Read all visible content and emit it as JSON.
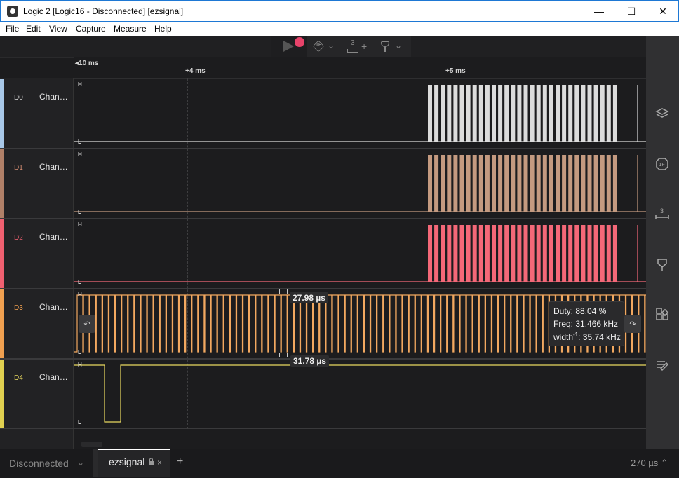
{
  "window": {
    "title": "Logic 2 [Logic16 - Disconnected] [ezsignal]",
    "minimize": "—",
    "maximize": "☐",
    "close": "✕"
  },
  "menu": [
    "File",
    "Edit",
    "View",
    "Capture",
    "Measure",
    "Help"
  ],
  "toolbar": {
    "record_color": "#e8436a",
    "analyzer_icon": "1F",
    "measure_count": "3",
    "measure_plus": "+",
    "chevron": "⌄"
  },
  "ruler": {
    "start_label": "10 ms",
    "marks": [
      {
        "label": "+4 ms"
      },
      {
        "label": "+5 ms"
      }
    ]
  },
  "channels": [
    {
      "id": "D0",
      "name": "Chan…",
      "color": "#a8c8e8",
      "wave_color": "#dcdcdc"
    },
    {
      "id": "D1",
      "name": "Chan…",
      "color": "#b08068",
      "wave_color": "#c49a80"
    },
    {
      "id": "D2",
      "name": "Chan…",
      "color": "#f06070",
      "wave_color": "#f46878"
    },
    {
      "id": "D3",
      "name": "Chan…",
      "color": "#f0a050",
      "wave_color": "#f2a860"
    },
    {
      "id": "D4",
      "name": "Chan…",
      "color": "#e0d050",
      "wave_color": "#e8d860"
    }
  ],
  "levels": {
    "high": "H",
    "low": "L"
  },
  "measurements": {
    "top_width": "27.98 µs",
    "bottom_width": "31.78 µs",
    "duty": "Duty: 88.04 %",
    "freq": "Freq: 31.466 kHz",
    "width_inv_prefix": "width",
    "width_inv_sup": "-1",
    "width_inv_value": ": 35.74 kHz"
  },
  "nav": {
    "prev": "↶",
    "next": "↷"
  },
  "sidebar": [
    "layers-icon",
    "analyzers-icon",
    "measurements-icon",
    "markers-icon",
    "extensions-icon",
    "notes-icon"
  ],
  "bottom": {
    "status": "Disconnected",
    "tab_label": "ezsignal",
    "tab_close": "×",
    "add_tab": "+",
    "zoom": "270 µs"
  }
}
